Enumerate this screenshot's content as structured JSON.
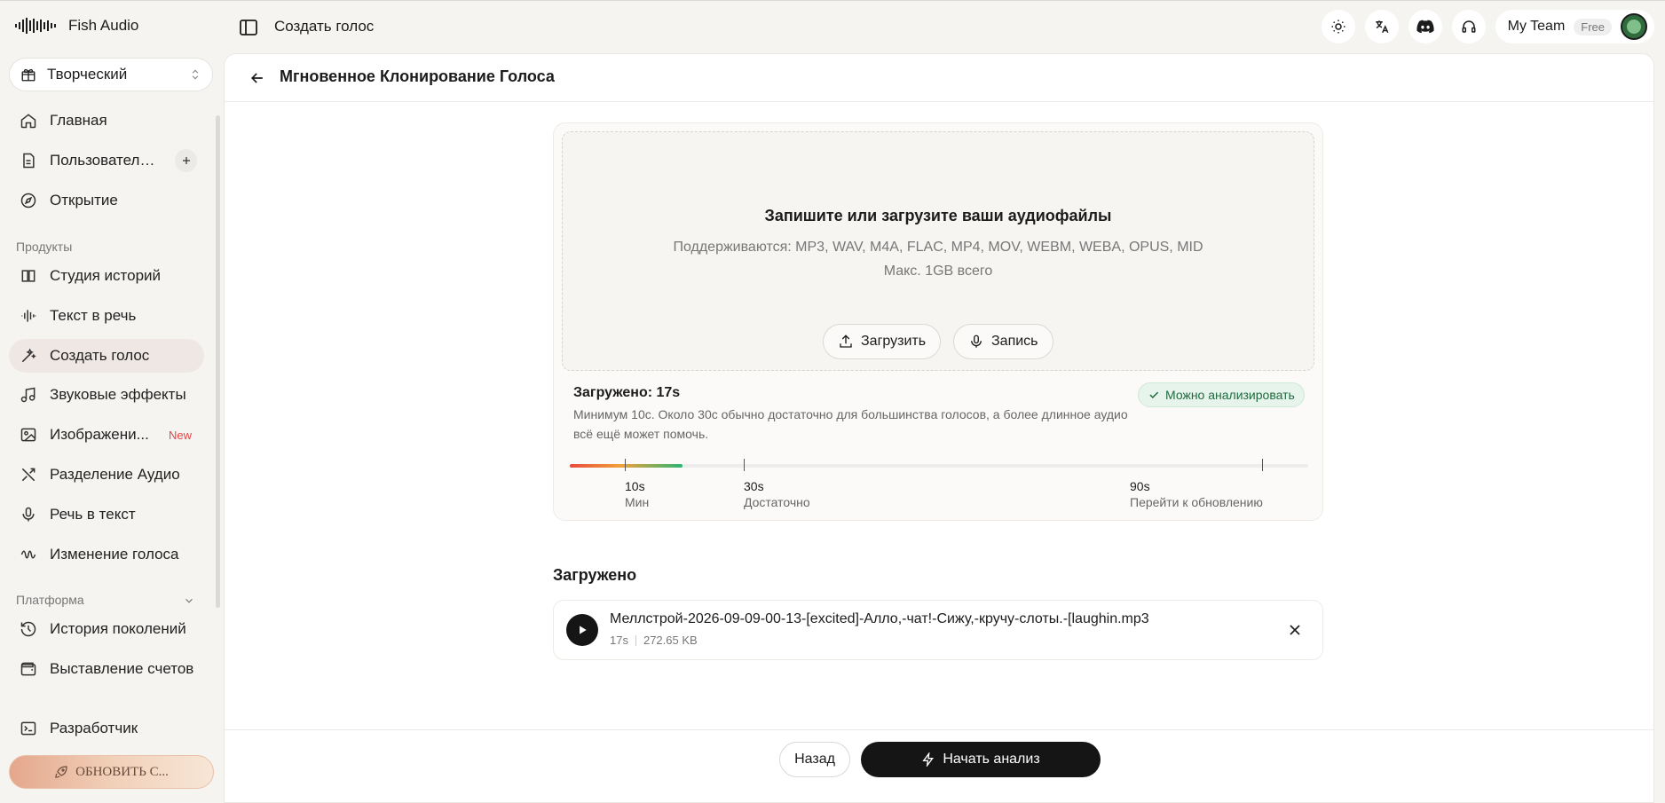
{
  "app": {
    "name": "Fish Audio"
  },
  "topbar": {
    "title": "Создать голос",
    "team_name": "My Team",
    "plan_badge": "Free"
  },
  "sidebar": {
    "workspace": "Творческий",
    "section_products": "Продукты",
    "section_platform": "Платформа",
    "upgrade_label": "ОБНОВИТЬ С...",
    "items": [
      {
        "label": "Главная",
        "icon": "home-icon"
      },
      {
        "label": "Пользовательс...",
        "icon": "document-icon"
      },
      {
        "label": "Открытие",
        "icon": "compass-icon"
      },
      {
        "label": "Студия историй",
        "icon": "story-icon"
      },
      {
        "label": "Текст в речь",
        "icon": "waveform-icon"
      },
      {
        "label": "Создать голос",
        "icon": "magic-wand-icon"
      },
      {
        "label": "Звуковые эффекты",
        "icon": "music-note-icon"
      },
      {
        "label": "Изображени...",
        "icon": "image-icon",
        "badge": "New"
      },
      {
        "label": "Разделение Аудио",
        "icon": "split-icon"
      },
      {
        "label": "Речь в текст",
        "icon": "microphone-icon"
      },
      {
        "label": "Изменение голоса",
        "icon": "voice-change-icon"
      },
      {
        "label": "История поколений",
        "icon": "history-icon"
      },
      {
        "label": "Выставление счетов",
        "icon": "wallet-icon"
      },
      {
        "label": "Разработчик",
        "icon": "terminal-icon"
      }
    ]
  },
  "main": {
    "page_title": "Мгновенное Клонирование Голоса",
    "dropzone": {
      "title": "Запишите или загрузите ваши аудиофайлы",
      "formats": "Поддерживаются: MP3, WAV, M4A, FLAC, MP4, MOV, WEBM, WEBA, OPUS, MID",
      "max_size": "Макс. 1GB всего",
      "upload_label": "Загрузить",
      "record_label": "Запись"
    },
    "status": {
      "uploaded": "Загружено: 17s",
      "description": "Минимум 10с. Около 30с обычно достаточно для большинства голосов, а более длинное аудио всё ещё может помочь.",
      "badge": "Можно анализировать",
      "progress_seconds": 17
    },
    "ticks": [
      {
        "value": "10s",
        "caption": "Мин"
      },
      {
        "value": "30s",
        "caption": "Достаточно"
      },
      {
        "value": "90s",
        "caption": "Перейти к обновлению"
      }
    ],
    "uploaded_title": "Загружено",
    "file": {
      "name": "Меллстрой-2026-09-09-00-13-[excited]-Алло,-чат!-Сижу,-кручу-слоты.-[laughin.mp3",
      "duration": "17s",
      "size": "272.65 KB"
    },
    "footer": {
      "back_label": "Назад",
      "start_label": "Начать анализ"
    }
  }
}
